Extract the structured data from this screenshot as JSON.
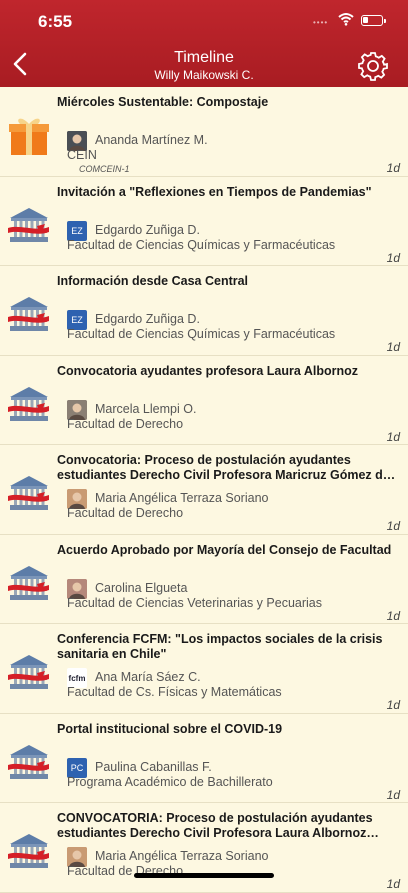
{
  "status": {
    "time": "6:55",
    "signal": "••••"
  },
  "header": {
    "title": "Timeline",
    "subtitle": "Willy Maikowski C."
  },
  "items": [
    {
      "title": "Miércoles Sustentable: Compostaje",
      "icon": "gift-icon",
      "author": "Ananda Martínez M.",
      "unit": "CEIN",
      "tag": "COMCEIN-1",
      "age": "1d",
      "avatar": "photo",
      "avatar_color": "#4a4f55"
    },
    {
      "title": "Invitación a \"Reflexiones en Tiempos de Pandemias\"",
      "icon": "university-icon",
      "author": "Edgardo Zuñiga D.",
      "unit": "Facultad de Ciencias Químicas y Farmacéuticas",
      "age": "1d",
      "avatar": "EZ",
      "avatar_color": "#2e62b0"
    },
    {
      "title": "Información desde Casa Central",
      "icon": "university-icon",
      "author": "Edgardo Zuñiga D.",
      "unit": "Facultad de Ciencias Químicas y Farmacéuticas",
      "age": "1d",
      "avatar": "EZ",
      "avatar_color": "#2e62b0"
    },
    {
      "title": "Convocatoria ayudantes profesora Laura Albornoz",
      "icon": "university-icon",
      "author": "Marcela Llempi O.",
      "unit": "Facultad de Derecho",
      "age": "1d",
      "avatar": "photo",
      "avatar_color": "#8a7f74"
    },
    {
      "title": "Convocatoria: Proceso de postulación ayudantes estudiantes Derecho Civil Profesora Maricruz Gómez de la Torre",
      "icon": "university-icon",
      "author": "Maria Angélica Terraza Soriano",
      "unit": "Facultad de Derecho",
      "age": "1d",
      "avatar": "photo",
      "avatar_color": "#c99b73"
    },
    {
      "title": "Acuerdo Aprobado por Mayoría del Consejo de Facultad",
      "icon": "university-icon",
      "author": "Carolina Elgueta",
      "unit": "Facultad de Ciencias Veterinarias y Pecuarias",
      "age": "1d",
      "avatar": "photo",
      "avatar_color": "#b5887a"
    },
    {
      "title": "Conferencia FCFM: \"Los impactos sociales de la crisis sanitaria en Chile\"",
      "icon": "university-icon",
      "author": "Ana María Sáez C.",
      "unit": "Facultad de Cs. Físicas y Matemáticas",
      "age": "1d",
      "avatar": "fcfm",
      "avatar_color": "#ffffff"
    },
    {
      "title": "Portal institucional sobre el COVID-19",
      "icon": "university-icon",
      "author": "Paulina Cabanillas F.",
      "unit": "Programa Académico de Bachillerato",
      "age": "1d",
      "avatar": "PC",
      "avatar_color": "#2e62b0"
    },
    {
      "title": "CONVOCATORIA:  Proceso de postulación ayudantes estudiantes Derecho Civil  Profesora Laura Albornoz Pollmann",
      "icon": "university-icon",
      "author": "Maria Angélica Terraza Soriano",
      "unit": "Facultad de Derecho",
      "age": "1d",
      "avatar": "photo",
      "avatar_color": "#c99b73"
    }
  ],
  "colors": {
    "header": "#b3222a",
    "background": "#fdf8e1"
  }
}
